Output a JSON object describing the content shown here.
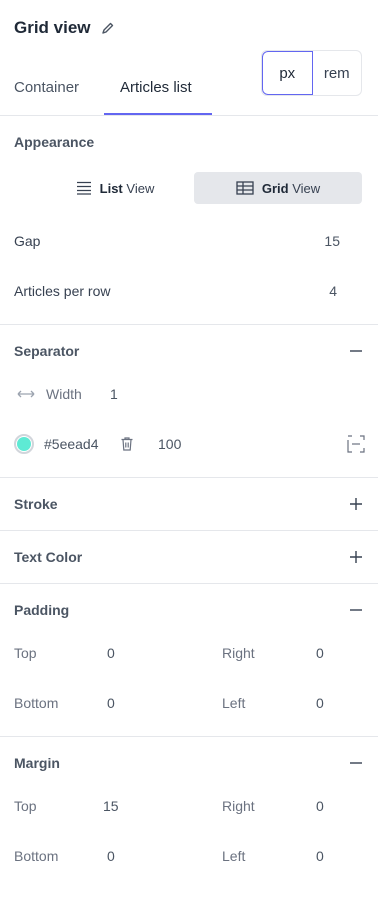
{
  "header": {
    "title": "Grid view",
    "tabs": [
      {
        "label": "Container"
      },
      {
        "label": "Articles list"
      }
    ],
    "units": [
      "px",
      "rem"
    ]
  },
  "appearance": {
    "title": "Appearance",
    "list_view": {
      "bold": "List",
      "label": "View"
    },
    "grid_view": {
      "bold": "Grid",
      "label": "View"
    },
    "gap_label": "Gap",
    "gap_value": "15",
    "per_row_label": "Articles per row",
    "per_row_value": "4"
  },
  "separator": {
    "title": "Separator",
    "width_label": "Width",
    "width_value": "1",
    "color": "#5eead4",
    "color_label": "#5eead4",
    "opacity": "100"
  },
  "stroke": {
    "title": "Stroke"
  },
  "text_color": {
    "title": "Text Color"
  },
  "padding": {
    "title": "Padding",
    "top_label": "Top",
    "top": "0",
    "right_label": "Right",
    "right": "0",
    "bottom_label": "Bottom",
    "bottom": "0",
    "left_label": "Left",
    "left": "0"
  },
  "margin": {
    "title": "Margin",
    "top_label": "Top",
    "top": "15",
    "right_label": "Right",
    "right": "0",
    "bottom_label": "Bottom",
    "bottom": "0",
    "left_label": "Left",
    "left": "0"
  },
  "colors": {
    "accent": "#6366f1",
    "swatch": "#5eead4"
  }
}
